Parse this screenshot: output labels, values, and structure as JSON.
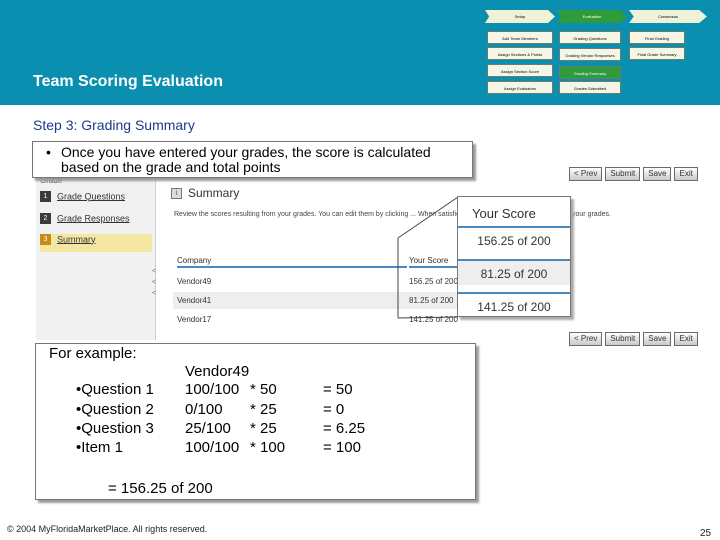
{
  "header": {
    "title": "Team Scoring Evaluation",
    "flow_row1": [
      "Setup",
      "Evaluation",
      "Consensus"
    ],
    "flow_col1": [
      "Add Team Members",
      "Assign Sections & Points",
      "Assign Section Score",
      "Assign Evaluators"
    ],
    "flow_col2": [
      "Grading Questions",
      "Grading Vendor Responses",
      "Grading Summary",
      "Grades Submitted"
    ],
    "flow_col3": [
      "Final Grading",
      "Final Grade Summary"
    ]
  },
  "step_title": "Step 3: Grading Summary",
  "callout": {
    "bullet": "•",
    "text": "Once you have entered your grades, the score is calculated based on the grade and total points"
  },
  "app": {
    "nav_header": "Grade",
    "nav_items": [
      {
        "num": "1",
        "label": "Grade Questions"
      },
      {
        "num": "2",
        "label": "Grade Responses"
      },
      {
        "num": "3",
        "label": "Summary"
      }
    ],
    "toolbar": [
      "< Prev",
      "Submit",
      "Save",
      "Exit"
    ],
    "summary_icon": "i",
    "summary_title": "Summary",
    "summary_desc": "Review the scores resulting from your grades. You can edit them by clicking ... When satisfied with those scores you can Submit your grades.",
    "columns": [
      "Company",
      "Your Score"
    ],
    "rows": [
      {
        "company": "Vendor49",
        "score": "156.25 of 200"
      },
      {
        "company": "Vendor41",
        "score": "81.25 of 200"
      },
      {
        "company": "Vendor17",
        "score": "141.25 of 200"
      }
    ],
    "scroll_marks": [
      "<",
      "<",
      "<"
    ]
  },
  "zoom": {
    "header": "Your Score",
    "scores": [
      "156.25 of 200",
      "81.25 of 200",
      "141.25 of 200"
    ]
  },
  "example": {
    "heading": "For example:",
    "vendor": "Vendor49",
    "rows": [
      {
        "label": "•Question 1",
        "frac": "100/100",
        "mult": "* 50",
        "result": "= 50"
      },
      {
        "label": "•Question 2",
        "frac": "0/100",
        "mult": "* 25",
        "result": "= 0"
      },
      {
        "label": "•Question 3",
        "frac": "25/100",
        "mult": "* 25",
        "result": "= 6.25"
      },
      {
        "label": "•Item 1",
        "frac": "100/100",
        "mult": "* 100",
        "result": "= 100"
      }
    ],
    "total": "= 156.25 of 200"
  },
  "footer": "© 2004 MyFloridaMarketPlace. All rights reserved.",
  "page_number": "25",
  "colors": {
    "header_bg": "#0b8fb0",
    "step_title": "#1a3a8a",
    "accent_green": "#2f9b3a",
    "table_rule": "#4a89c0"
  }
}
